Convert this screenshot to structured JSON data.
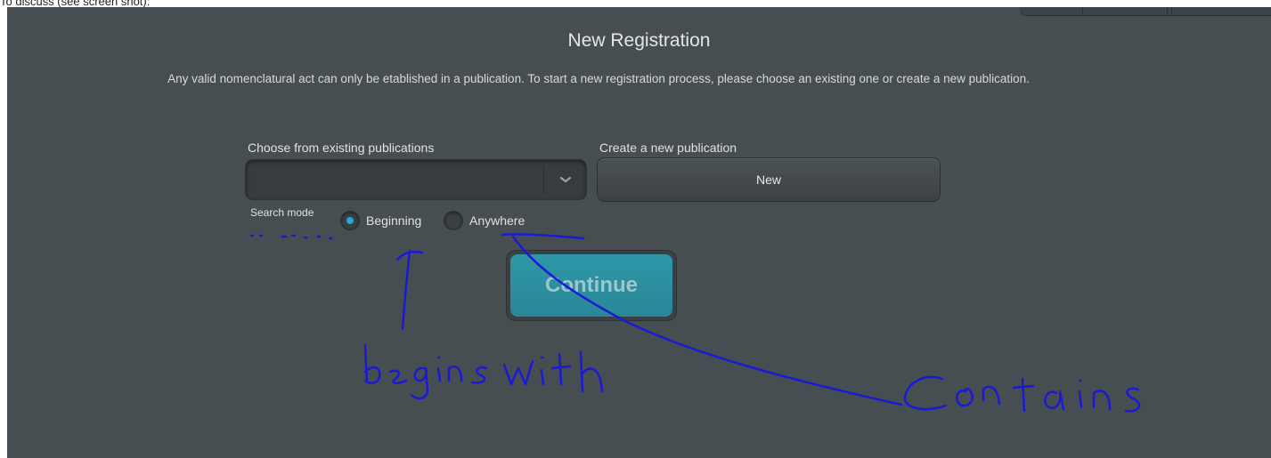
{
  "note": "To discuss (see screen shot):",
  "page": {
    "title": "New Registration",
    "intro": "Any valid nomenclatural act can only be etablished in a publication. To start a new registration process, please choose an existing one or create a new publication."
  },
  "existing": {
    "label": "Choose from existing publications",
    "value": ""
  },
  "create": {
    "label": "Create a new publication",
    "button": "New"
  },
  "search_mode": {
    "label": "Search mode",
    "options": [
      {
        "label": "Beginning",
        "selected": true
      },
      {
        "label": "Anywhere",
        "selected": false
      }
    ]
  },
  "continue_label": "Continue",
  "annotations": {
    "left": "begins with",
    "right": "Contains"
  },
  "colors": {
    "background": "#474e52",
    "accent": "#21a9d8",
    "continue": "#2e97a8",
    "annotation_ink": "#1a1ad6"
  }
}
